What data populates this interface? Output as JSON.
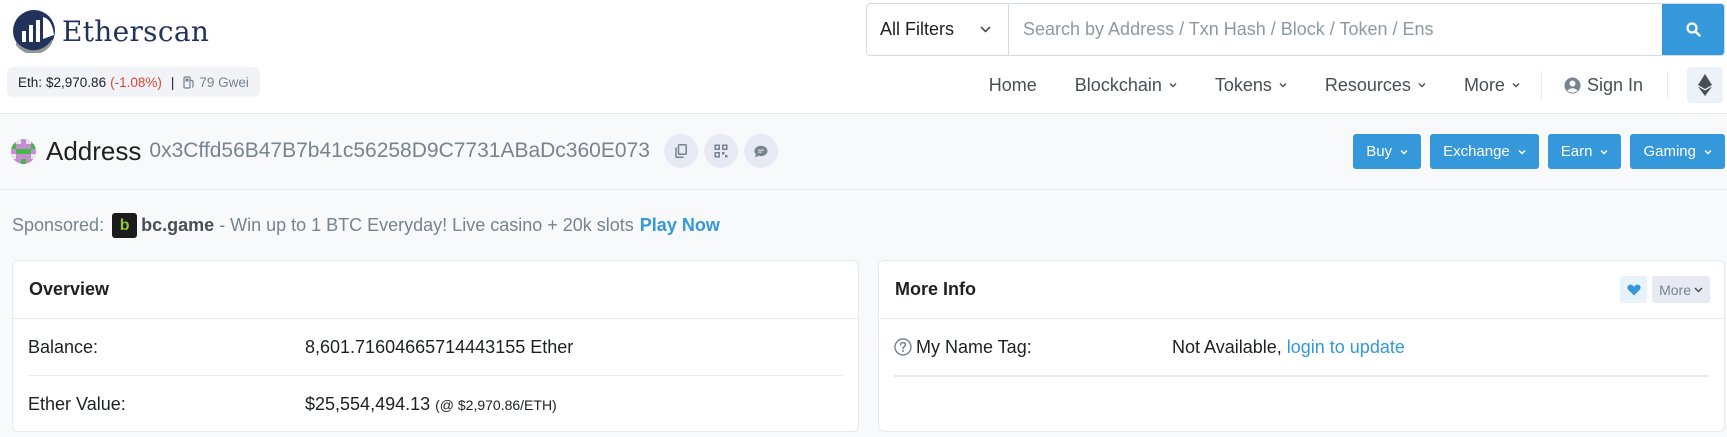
{
  "brand": {
    "name": "Etherscan"
  },
  "ticker": {
    "eth_label": "Eth:",
    "eth_price": "$2,970.86",
    "eth_change": "(-1.08%)",
    "separator": "|",
    "gas": "79 Gwei"
  },
  "search": {
    "filter_label": "All Filters",
    "placeholder": "Search by Address / Txn Hash / Block / Token / Ens"
  },
  "nav": {
    "items": [
      {
        "label": "Home"
      },
      {
        "label": "Blockchain"
      },
      {
        "label": "Tokens"
      },
      {
        "label": "Resources"
      },
      {
        "label": "More"
      }
    ],
    "signin": "Sign In"
  },
  "address": {
    "label": "Address",
    "hash": "0x3Cffd56B47B7b41c56258D9C7731ABaDc360E073"
  },
  "tools": [
    {
      "label": "Buy"
    },
    {
      "label": "Exchange"
    },
    {
      "label": "Earn"
    },
    {
      "label": "Gaming"
    }
  ],
  "sponsored": {
    "prefix": "Sponsored:",
    "brand_mark": "b",
    "brand": "bc.game",
    "text": "- Win up to 1 BTC Everyday! Live casino + 20k slots",
    "cta": "Play Now"
  },
  "overview": {
    "title": "Overview",
    "balance_label": "Balance:",
    "balance_value": "8,601.71604665714443155 Ether",
    "ether_value_label": "Ether Value:",
    "ether_value": "$25,554,494.13",
    "ether_value_rate": "(@ $2,970.86/ETH)"
  },
  "more_info": {
    "title": "More Info",
    "more_label": "More",
    "name_tag_label": "My Name Tag:",
    "name_tag_value": "Not Available,",
    "name_tag_link": "login to update"
  },
  "colors": {
    "accent": "#3498db",
    "negative": "#de4437",
    "brand_dark": "#21325b"
  }
}
